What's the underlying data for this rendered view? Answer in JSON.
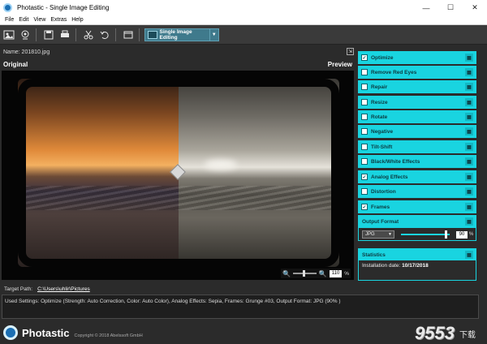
{
  "window": {
    "title": "Photastic - Single Image Editing",
    "controls": [
      "—",
      "☐",
      "✕"
    ]
  },
  "menu": [
    "File",
    "Edit",
    "View",
    "Extras",
    "Help"
  ],
  "toolbar": {
    "mode_label": "Single Image Editing"
  },
  "file": {
    "name_label": "Name: 201810.jpg"
  },
  "viewer": {
    "original_label": "Original",
    "preview_label": "Preview",
    "zoom_value": "110",
    "zoom_unit": "%"
  },
  "sidebar": {
    "items": [
      {
        "label": "Optimize",
        "checked": true
      },
      {
        "label": "Remove Red Eyes",
        "checked": false
      },
      {
        "label": "Repair",
        "checked": false
      },
      {
        "label": "Resize",
        "checked": false
      },
      {
        "label": "Rotate",
        "checked": false
      },
      {
        "label": "Negative",
        "checked": false
      },
      {
        "label": "Tilt-Shift",
        "checked": false
      },
      {
        "label": "Black/White Effects",
        "checked": false
      },
      {
        "label": "Analog Effects",
        "checked": true
      },
      {
        "label": "Distortion",
        "checked": false
      },
      {
        "label": "Frames",
        "checked": true
      }
    ],
    "output_format": {
      "header": "Output Format",
      "format": "JPG",
      "quality": "90",
      "quality_unit": "%",
      "quality_level": 0.9
    },
    "statistics": {
      "header": "Statistics",
      "installation_label": "Installation date:",
      "installation_value": "10/17/2018"
    }
  },
  "target": {
    "label": "Target Path:",
    "path": "C:\\Users\\uhlir\\Pictures"
  },
  "settings": {
    "text": "Used Settings: Optimize (Strength: Auto Correction, Color: Auto Color), Analog Effects: Sepia, Frames: Grunge #03, Output Format: JPG (90% )"
  },
  "footer": {
    "brand": "Photastic",
    "copyright": "Copyright © 2018 Abelssoft GmbH",
    "watermark": "9553",
    "watermark_sub": "下载"
  },
  "colors": {
    "accent": "#19d4e0",
    "background": "#2b2b2b"
  }
}
